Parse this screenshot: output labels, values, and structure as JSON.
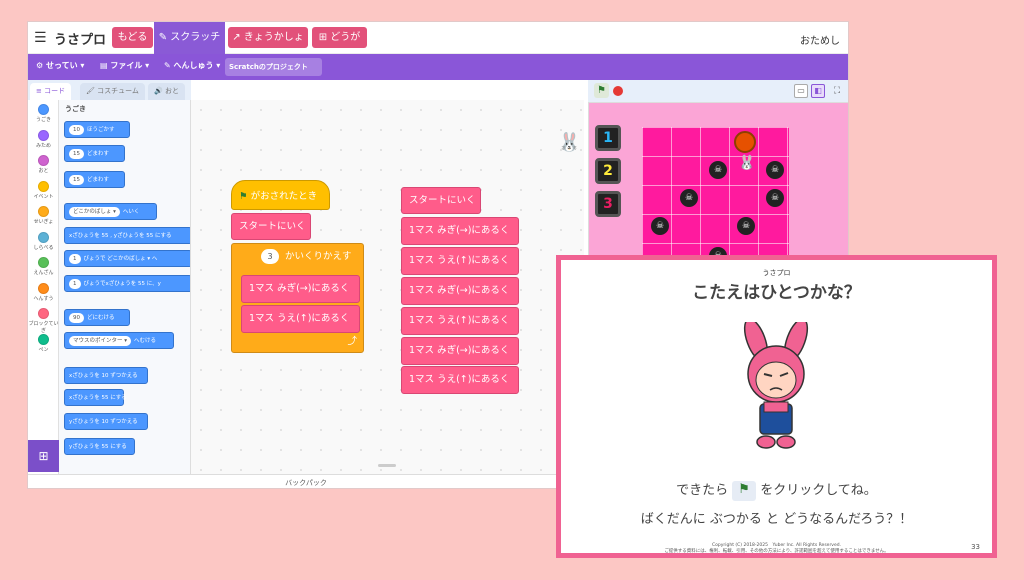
{
  "topbar": {
    "brand": "うさプロ",
    "back_label": "もどる",
    "scratch_label": "スクラッチ",
    "textbook_label": "きょうかしょ",
    "video_label": "どうが",
    "tryout_label": "おためし"
  },
  "menubar": {
    "settings_label": "せってい",
    "file_label": "ファイル",
    "edit_label": "へんしゅう",
    "project_name": "Scratchのプロジェクト"
  },
  "tabs": {
    "code": "コード",
    "costume": "コスチューム",
    "sound": "おと"
  },
  "categories": [
    {
      "label": "うごき",
      "color": "#4c97ff"
    },
    {
      "label": "みため",
      "color": "#9966ff"
    },
    {
      "label": "おと",
      "color": "#cf63cf"
    },
    {
      "label": "イベント",
      "color": "#ffbf00"
    },
    {
      "label": "せいぎょ",
      "color": "#ffab19"
    },
    {
      "label": "しらべる",
      "color": "#5cb1d6"
    },
    {
      "label": "えんざん",
      "color": "#59c059"
    },
    {
      "label": "へんすう",
      "color": "#ff8c1a"
    },
    {
      "label": "ブロックていぎ",
      "color": "#ff6680"
    },
    {
      "label": "ペン",
      "color": "#0fbd8c"
    }
  ],
  "palette": {
    "section": "うごき",
    "blocks": [
      {
        "value": "10",
        "text": "ほうごかす"
      },
      {
        "value": "15",
        "text": "どまわす"
      },
      {
        "value": "15",
        "text": "どまわす"
      },
      {
        "value": "どこかのばしょ ▾",
        "text": "へいく"
      },
      {
        "value": "",
        "text": "xざひょうを 55 , yざひょうを 55 にする"
      },
      {
        "value": "1",
        "text": "びょうで どこかのばしょ ▾ へ"
      },
      {
        "value": "1",
        "text": "びょうでxざひょうを 55 に、y"
      },
      {
        "value": "90",
        "text": "どにむける"
      },
      {
        "value": "マウスのポインター ▾",
        "text": "へむける"
      },
      {
        "value": "",
        "text": "xざひょうを 10 ずつかえる"
      },
      {
        "value": "",
        "text": "xざひょうを 55 にする"
      },
      {
        "value": "",
        "text": "yざひょうを 10 ずつかえる"
      },
      {
        "value": "",
        "text": "yざひょうを 55 にする"
      }
    ]
  },
  "workspace": {
    "left_script": {
      "hat": "がおされたとき",
      "start": "スタートにいく",
      "repeat_count": "3",
      "repeat_label": "かいくりかえす",
      "inner": [
        "1マス みぎ(→)にあるく",
        "1マス うえ(↑)にあるく"
      ]
    },
    "right_script": [
      "スタートにいく",
      "1マス みぎ(→)にあるく",
      "1マス うえ(↑)にあるく",
      "1マス みぎ(→)にあるく",
      "1マス うえ(↑)にあるく",
      "1マス みぎ(→)にあるく",
      "1マス うえ(↑)にあるく"
    ],
    "backpack": "バックパック"
  },
  "stage": {
    "level_buttons": [
      {
        "label": "1",
        "color": "#29b6f6"
      },
      {
        "label": "2",
        "color": "#ffeb3b"
      },
      {
        "label": "3",
        "color": "#e91e63"
      }
    ]
  },
  "card": {
    "brand": "うさプロ",
    "title": "こたえはひとつかな？",
    "line1_pre": "できたら",
    "line1_post": "をクリックしてね。",
    "line2": "ばくだんに ぶつかる と どうなるんだろう？！",
    "copyright": "Copyright (C) 2018-2025　Yuber Inc. All Rights Reserved.",
    "notice": "ご提供する資料には、権利、転載、引用、その他の方法により、許諾範囲を超えて使用することはできません。",
    "page": "33"
  }
}
